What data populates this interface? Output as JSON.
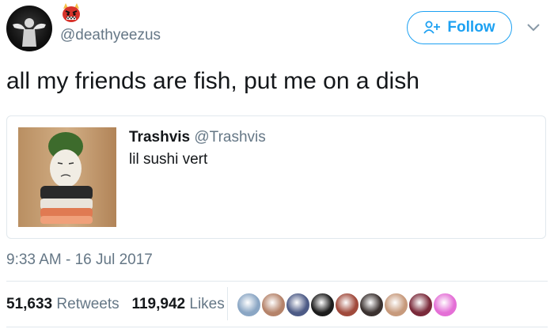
{
  "author": {
    "handle": "@deathyeezus",
    "avatar_icon": "winged-figure-avatar",
    "badge_icon": "japanese-ogre-emoji"
  },
  "follow_button": {
    "label": "Follow",
    "icon": "add-person-icon",
    "color": "#1da1f2"
  },
  "menu_icon": "chevron-down-icon",
  "tweet": {
    "text": "all my friends are fish, put me on a dish"
  },
  "quoted_tweet": {
    "name": "Trashvis",
    "handle": "@Trashvis",
    "text": "lil sushi vert",
    "image_icon": "sushi-character-photo"
  },
  "timestamp": "9:33 AM - 16 Jul 2017",
  "stats": {
    "retweets_count": "51,633",
    "retweets_label": "Retweets",
    "likes_count": "119,942",
    "likes_label": "Likes"
  },
  "likers": [
    {
      "color": "#8aa6c4"
    },
    {
      "color": "#b5836a"
    },
    {
      "color": "#4d5b86"
    },
    {
      "color": "#1d1d1d"
    },
    {
      "color": "#a04a3c"
    },
    {
      "color": "#3b3230"
    },
    {
      "color": "#c79a7c"
    },
    {
      "color": "#7a2a3a"
    },
    {
      "color": "#e46fd6"
    }
  ]
}
